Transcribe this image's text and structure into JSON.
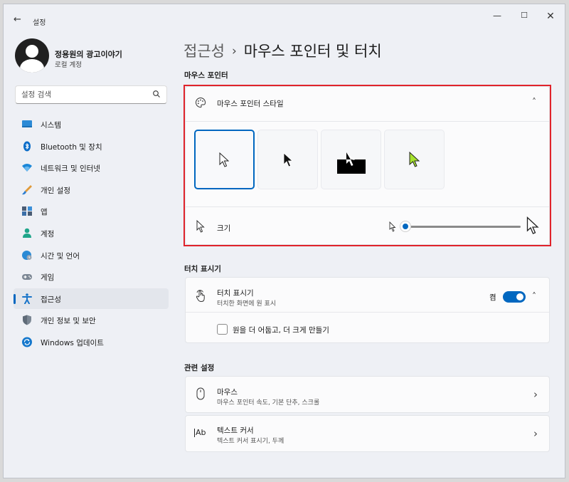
{
  "window": {
    "title": "설정",
    "back_glyph": "←",
    "minimize_glyph": "—",
    "maximize_glyph": "☐",
    "close_glyph": "✕"
  },
  "profile": {
    "name": "정용원의 광고이야기",
    "account_type": "로컬 계정"
  },
  "search": {
    "placeholder": "설정 검색"
  },
  "sidebar": {
    "items": [
      {
        "label": "시스템",
        "icon": "monitor-icon"
      },
      {
        "label": "Bluetooth 및 장치",
        "icon": "bluetooth-icon"
      },
      {
        "label": "네트워크 및 인터넷",
        "icon": "wifi-icon"
      },
      {
        "label": "개인 설정",
        "icon": "brush-icon"
      },
      {
        "label": "앱",
        "icon": "apps-icon"
      },
      {
        "label": "계정",
        "icon": "person-icon"
      },
      {
        "label": "시간 및 언어",
        "icon": "globe-clock-icon"
      },
      {
        "label": "게임",
        "icon": "gamepad-icon"
      },
      {
        "label": "접근성",
        "icon": "accessibility-icon",
        "active": true
      },
      {
        "label": "개인 정보 및 보안",
        "icon": "shield-icon"
      },
      {
        "label": "Windows 업데이트",
        "icon": "update-icon"
      }
    ]
  },
  "breadcrumb": {
    "parent": "접근성",
    "separator": "›",
    "current": "마우스 포인터 및 터치"
  },
  "sections": {
    "mouse_pointer": {
      "label": "마우스 포인터",
      "style_title": "마우스 포인터 스타일",
      "styles": [
        "white",
        "black",
        "inverted",
        "custom-lime"
      ],
      "selected_style": "white",
      "size_label": "크기",
      "size_value_fraction": 0.0
    },
    "touch": {
      "label": "터치 표시기",
      "title": "터치 표시기",
      "subtitle": "터치한 화면에 원 표시",
      "toggle_label": "켬",
      "toggle_on": true,
      "checkbox_label": "원을 더 어둡고, 더 크게 만들기",
      "checkbox_checked": false
    },
    "related": {
      "label": "관련 설정",
      "items": [
        {
          "title": "마우스",
          "subtitle": "마우스 포인터 속도, 기본 단추, 스크롤",
          "icon": "mouse-icon"
        },
        {
          "title": "텍스트 커서",
          "subtitle": "텍스트 커서 표시기, 두께",
          "icon": "text-cursor-icon",
          "icon_text": "Ab"
        }
      ]
    }
  },
  "colors": {
    "accent": "#0067c0",
    "highlight_border": "#e0232b",
    "custom_pointer": "#a6e22e"
  },
  "glyphs": {
    "chevron_up": "˄",
    "chevron_right": "›"
  }
}
